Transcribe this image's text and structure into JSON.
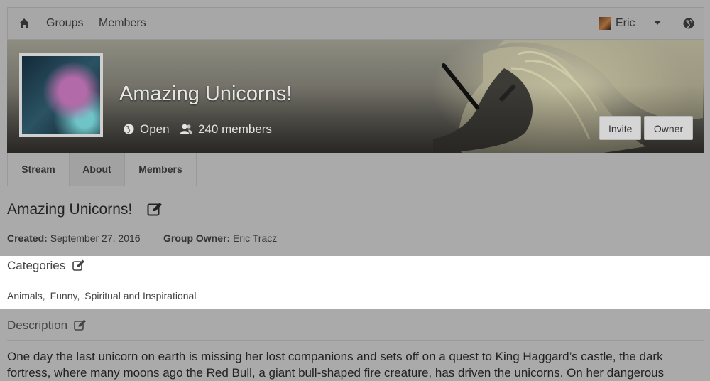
{
  "navbar": {
    "groups_label": "Groups",
    "members_label": "Members",
    "user_name": "Eric",
    "icons": [
      "home-icon",
      "user-avatar",
      "caret-down-icon",
      "globe-icon"
    ]
  },
  "banner": {
    "group_title": "Amazing Unicorns!",
    "privacy": "Open",
    "member_count": "240 members",
    "invite_label": "Invite",
    "owner_label": "Owner"
  },
  "tabs": [
    {
      "label": "Stream",
      "active": false
    },
    {
      "label": "About",
      "active": true
    },
    {
      "label": "Members",
      "active": false
    }
  ],
  "about": {
    "title": "Amazing Unicorns!",
    "created_label": "Created:",
    "created_value": "September 27, 2016",
    "owner_label": "Group Owner:",
    "owner_value": "Eric Tracz",
    "categories_heading": "Categories",
    "categories": [
      "Animals,",
      "Funny,",
      "Spiritual and Inspirational"
    ],
    "description_heading": "Description",
    "description": "One day the last unicorn on earth is missing her lost companions and sets off on a quest to King Haggard’s castle, the dark fortress, where many moons ago the Red Bull, a giant bull-shaped fire creature, has driven the unicorns. On her dangerous"
  },
  "colors": {
    "overlay": "#aaaaaa",
    "highlight": "#ffffff",
    "button_bg": "#d5d5d5"
  }
}
